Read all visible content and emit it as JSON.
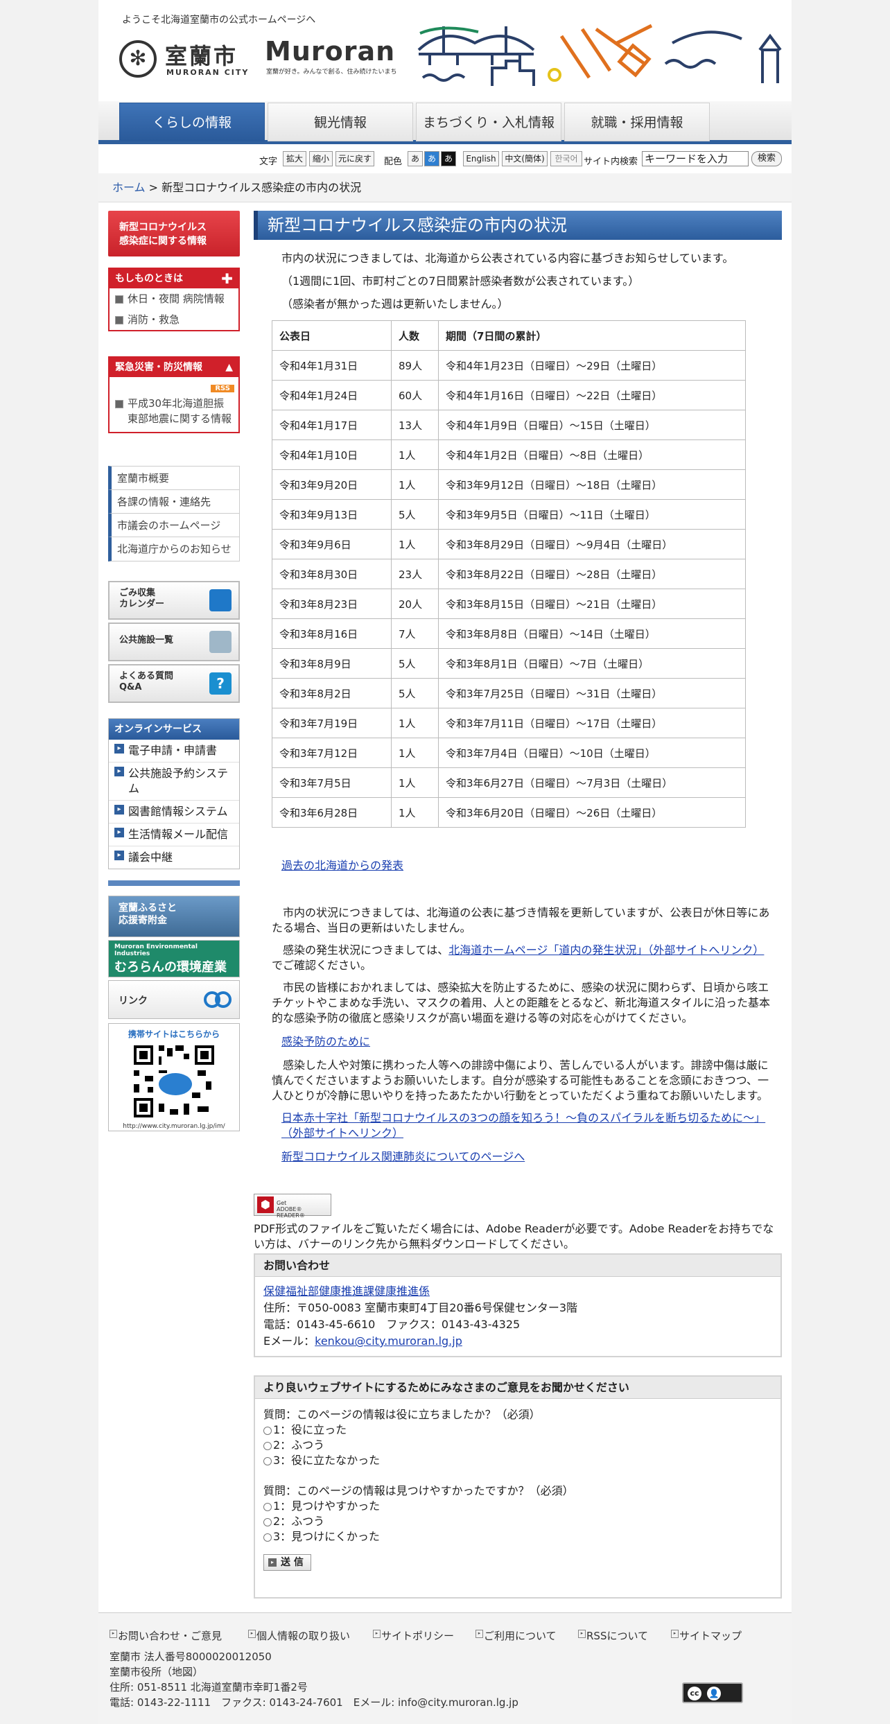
{
  "header": {
    "welcome": "ようこそ北海道室蘭市の公式ホームページへ",
    "city_kanji": "室蘭市",
    "city_roman": "MURORAN CITY",
    "brand_word": "Muroran",
    "brand_tag": "室蘭が好き。みんなで創る、住み続けたいまち"
  },
  "nav": {
    "tabs": [
      "くらしの情報",
      "観光情報",
      "まちづくり・入札情報",
      "就職・採用情報"
    ]
  },
  "util": {
    "font_label": "文字",
    "font_buttons": [
      "拡大",
      "縮小",
      "元に戻す"
    ],
    "color_label": "配色",
    "color_buttons": [
      "あ",
      "あ",
      "あ"
    ],
    "lang_buttons": [
      "English",
      "中文(簡体)",
      "한국어"
    ],
    "search_label": "サイト内検索",
    "search_value": "キーワードを入力",
    "search_button": "検索"
  },
  "breadcrumb": {
    "home": "ホーム",
    "separator": " > ",
    "current": "新型コロナウイルス感染症の市内の状況"
  },
  "sidebar": {
    "corona_line1": "新型コロナウイルス",
    "corona_line2": "感染症に関する情報",
    "emergency_head": "もしものときは",
    "emergency_items": [
      "休日・夜間 病院情報",
      "消防・救急"
    ],
    "disaster_head": "緊急災害・防災情報",
    "rss": "RSS",
    "disaster_items": [
      "平成30年北海道胆振東部地震に関する情報"
    ],
    "gray_links": [
      "室蘭市概要",
      "各課の情報・連絡先",
      "市議会のホームページ",
      "北海道庁からのお知らせ"
    ],
    "banners": [
      {
        "line1": "ごみ収集",
        "line2": "カレンダー"
      },
      {
        "line1": "公共施設一覧",
        "line2": ""
      },
      {
        "line1": "よくある質問",
        "line2": "Q&A"
      }
    ],
    "online_head": "オンラインサービス",
    "online_items": [
      "電子申請・申請書",
      "公共施設予約システム",
      "図書館情報システム",
      "生活情報メール配信",
      "議会中継"
    ],
    "furusato_line1": "室蘭ふるさと",
    "furusato_line2": "応援寄附金",
    "env_line1": "Muroran Environmental Industries",
    "env_line2": "むろらんの環境産業",
    "link_label": "リンク",
    "mobile_title": "携帯サイトはこちらから",
    "mobile_url": "http://www.city.muroran.lg.jp/im/"
  },
  "main": {
    "title": "新型コロナウイルス感染症の市内の状況",
    "intro": "市内の状況につきましては、北海道から公表されている内容に基づきお知らせしています。",
    "note1": "（1週間に1回、市町村ごとの7日間累計感染者数が公表されています。）",
    "note2": "（感染者が無かった週は更新いたしません。）",
    "table": {
      "headers": [
        "公表日",
        "人数",
        "期間（7日間の累計）"
      ],
      "rows": [
        [
          "令和4年1月31日",
          "89人",
          "令和4年1月23日（日曜日）～29日（土曜日）"
        ],
        [
          "令和4年1月24日",
          "60人",
          "令和4年1月16日（日曜日）～22日（土曜日）"
        ],
        [
          "令和4年1月17日",
          "13人",
          "令和4年1月9日（日曜日）～15日（土曜日）"
        ],
        [
          "令和4年1月10日",
          "1人",
          "令和4年1月2日（日曜日）～8日（土曜日）"
        ],
        [
          "令和3年9月20日",
          "1人",
          "令和3年9月12日（日曜日）～18日（土曜日）"
        ],
        [
          "令和3年9月13日",
          "5人",
          "令和3年9月5日（日曜日）～11日（土曜日）"
        ],
        [
          "令和3年9月6日",
          "1人",
          "令和3年8月29日（日曜日）～9月4日（土曜日）"
        ],
        [
          "令和3年8月30日",
          "23人",
          "令和3年8月22日（日曜日）～28日（土曜日）"
        ],
        [
          "令和3年8月23日",
          "20人",
          "令和3年8月15日（日曜日）～21日（土曜日）"
        ],
        [
          "令和3年8月16日",
          "7人",
          "令和3年8月8日（日曜日）～14日（土曜日）"
        ],
        [
          "令和3年8月9日",
          "5人",
          "令和3年8月1日（日曜日）～7日（土曜日）"
        ],
        [
          "令和3年8月2日",
          "5人",
          "令和3年7月25日（日曜日）～31日（土曜日）"
        ],
        [
          "令和3年7月19日",
          "1人",
          "令和3年7月11日（日曜日）～17日（土曜日）"
        ],
        [
          "令和3年7月12日",
          "1人",
          "令和3年7月4日（日曜日）～10日（土曜日）"
        ],
        [
          "令和3年7月5日",
          "1人",
          "令和3年6月27日（日曜日）～7月3日（土曜日）"
        ],
        [
          "令和3年6月28日",
          "1人",
          "令和3年6月20日（日曜日）～26日（土曜日）"
        ]
      ]
    },
    "past_link": "過去の北海道からの発表",
    "p1": "市内の状況につきましては、北海道の公表に基づき情報を更新していますが、公表日が休日等にあたる場合、当日の更新はいたしません。",
    "p2_pre": "感染の発生状況につきましては、",
    "p2_link": "北海道ホームページ「道内の発生状況」（外部サイトへリンク）",
    "p2_post": "でご確認ください。",
    "p3": "市民の皆様におかれましては、感染拡大を防止するために、感染の状況に関わらず、日頃から咳エチケットやこまめな手洗い、マスクの着用、人との距離をとるなど、新北海道スタイルに沿った基本的な感染予防の徹底と感染リスクが高い場面を避ける等の対応を心がけてください。",
    "prevention_link": "感染予防のために",
    "p4": "感染した人や対策に携わった人等への誹謗中傷により、苦しんでいる人がいます。誹謗中傷は厳に慎んでくださいますようお願いいたします。自分が感染する可能性もあることを念頭におきつつ、一人ひとりが冷静に思いやりを持ったあたたかい行動をとっていただくよう重ねてお願いいたします。",
    "redcross_link": "日本赤十字社「新型コロナウイルスの3つの顔を知ろう！～負のスパイラルを断ち切るために～」（外部サイトへリンク）",
    "pneumonia_link": "新型コロナウイルス関連肺炎についてのページへ",
    "pdf_badge_line1": "Get",
    "pdf_badge_line2": "ADOBE® READER®",
    "pdf_note": "PDF形式のファイルをご覧いただく場合には、Adobe Readerが必要です。Adobe Readerをお持ちでない方は、バナーのリンク先から無料ダウンロードしてください。"
  },
  "contact": {
    "head": "お問い合わせ",
    "dept": "保健福祉部健康推進課健康推進係",
    "address": "住所：〒050-0083 室蘭市東町4丁目20番6号保健センター3階",
    "phone": "電話：0143-45-6610　ファクス：0143-43-4325",
    "email_label": "Eメール：",
    "email": "kenkou@city.muroran.lg.jp"
  },
  "feedback": {
    "head": "より良いウェブサイトにするためにみなさまのご意見をお聞かせください",
    "q1": "質問：このページの情報は役に立ちましたか？（必須）",
    "q1_options": [
      "1：役に立った",
      "2：ふつう",
      "3：役に立たなかった"
    ],
    "q2": "質問：このページの情報は見つけやすかったですか？（必須）",
    "q2_options": [
      "1：見つけやすかった",
      "2：ふつう",
      "3：見つけにくかった"
    ],
    "submit": "送 信"
  },
  "footer": {
    "links": [
      "お問い合わせ・ご意見",
      "個人情報の取り扱い",
      "サイトポリシー",
      "ご利用について",
      "RSSについて",
      "サイトマップ"
    ],
    "corp_no": "室蘭市 法人番号8000020012050",
    "office": "室蘭市役所（地図）",
    "address": "住所: 051-8511 北海道室蘭市幸町1番2号",
    "contact": "電話: 0143-22-1111　ファクス: 0143-24-7601　Eメール: info@city.muroran.lg.jp",
    "cc_label": "cc"
  },
  "colors": {
    "brand_blue": "#2f5f9d",
    "alert_red": "#d0202a",
    "link_blue": "#1a3fb0"
  }
}
